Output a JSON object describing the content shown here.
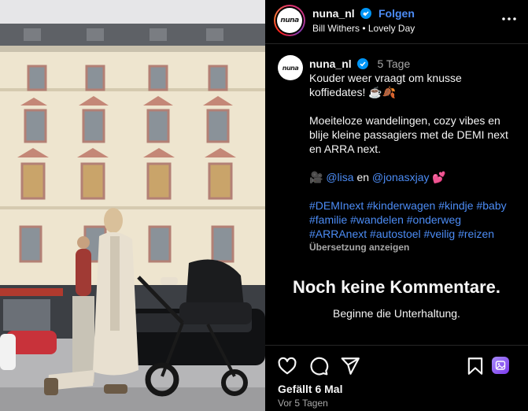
{
  "header": {
    "username": "nuna_nl",
    "follow_label": "Folgen",
    "separator": "•",
    "audio": "Bill Withers • Lovely Day",
    "brand_text": "nuna"
  },
  "caption": {
    "username": "nuna_nl",
    "time": "5 Tage",
    "line1": "Kouder weer vraagt om knusse koffiedates! ☕🍂",
    "line2": "Moeiteloze wandelingen, cozy vibes en blije kleine passagiers met de DEMI next en ARRA next.",
    "credit_prefix": "🎥",
    "mention1": "@lisa",
    "credit_and": "en",
    "mention2": "@jonasxjay",
    "credit_suffix": "💕",
    "hashtags": "#DEMInext #kinderwagen #kindje #baby #familie #wandelen #onderweg #ARRAnext #autostoel #veilig #reizen",
    "translate_label": "Übersetzung anzeigen"
  },
  "comments": {
    "empty_title": "Noch keine Kommentare.",
    "empty_sub": "Beginne die Unterhaltung."
  },
  "actions": {
    "likes": "Gefällt 6 Mal",
    "posted_ago": "Vor 5 Tagen",
    "icons": [
      "heart-icon",
      "comment-icon",
      "share-icon",
      "bookmark-icon",
      "saved-collection-icon"
    ]
  },
  "colors": {
    "background": "#000000",
    "link_blue": "#4c8cf5",
    "muted_text": "#a8a8a8",
    "divider": "#262626"
  }
}
